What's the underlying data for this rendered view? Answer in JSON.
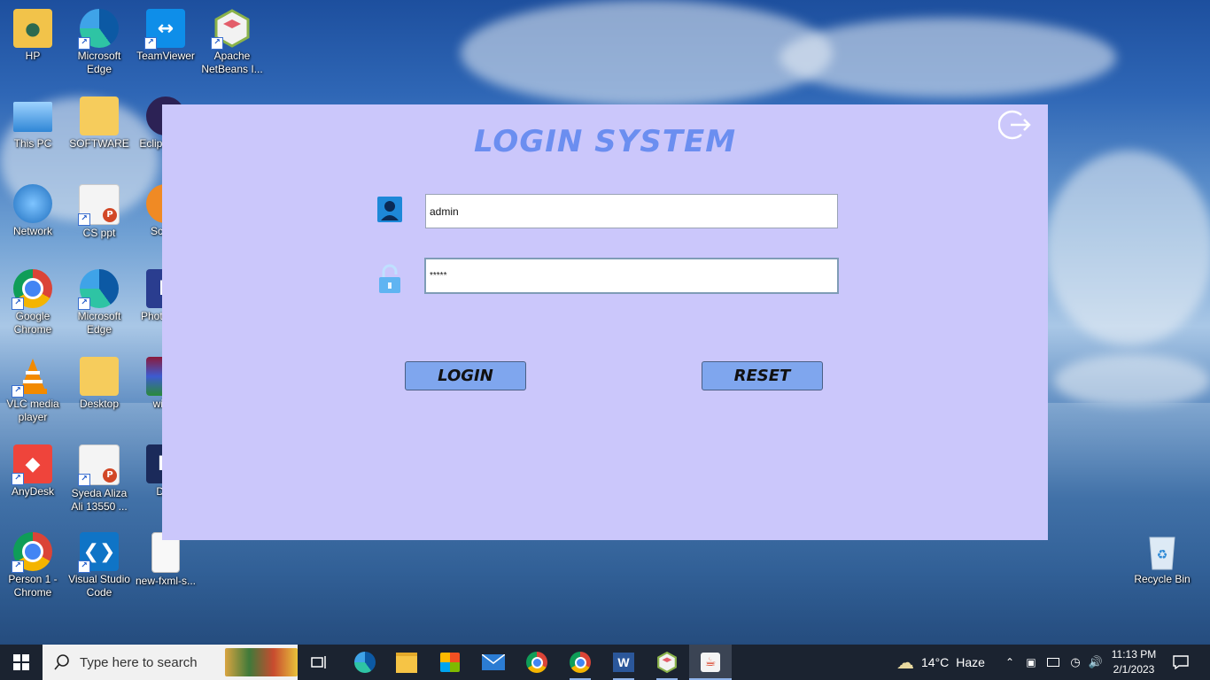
{
  "desktop": {
    "icons": [
      {
        "label": "HP"
      },
      {
        "label": "Microsoft Edge"
      },
      {
        "label": "TeamViewer"
      },
      {
        "label": "Apache NetBeans I..."
      },
      {
        "label": "This PC"
      },
      {
        "label": "SOFTWARE"
      },
      {
        "label": "Eclip for Ja"
      },
      {
        "label": "Network"
      },
      {
        "label": "CS ppt"
      },
      {
        "label": "Scene"
      },
      {
        "label": "Google Chrome"
      },
      {
        "label": "Microsoft Edge"
      },
      {
        "label": "Photo Sho"
      },
      {
        "label": "VLC media player"
      },
      {
        "label": "Desktop"
      },
      {
        "label": "winra"
      },
      {
        "label": "AnyDesk"
      },
      {
        "label": "Syeda Aliza Ali 13550 ..."
      },
      {
        "label": "Dev"
      },
      {
        "label": "Person 1 - Chrome"
      },
      {
        "label": "Visual Studio Code"
      },
      {
        "label": "new-fxml-s..."
      },
      {
        "label": "Recycle Bin"
      }
    ]
  },
  "login": {
    "title": "LOGIN SYSTEM",
    "username_value": "admin",
    "password_value": "*****",
    "login_label": "LOGIN",
    "reset_label": "RESET",
    "background": "#cbc7fb",
    "title_color": "#6b8ef0",
    "button_color": "#7fa6ee"
  },
  "taskbar": {
    "search_placeholder": "Type here to search",
    "weather": {
      "temp": "14°C",
      "condition": "Haze"
    },
    "clock": {
      "time": "11:13 PM",
      "date": "2/1/2023"
    }
  }
}
